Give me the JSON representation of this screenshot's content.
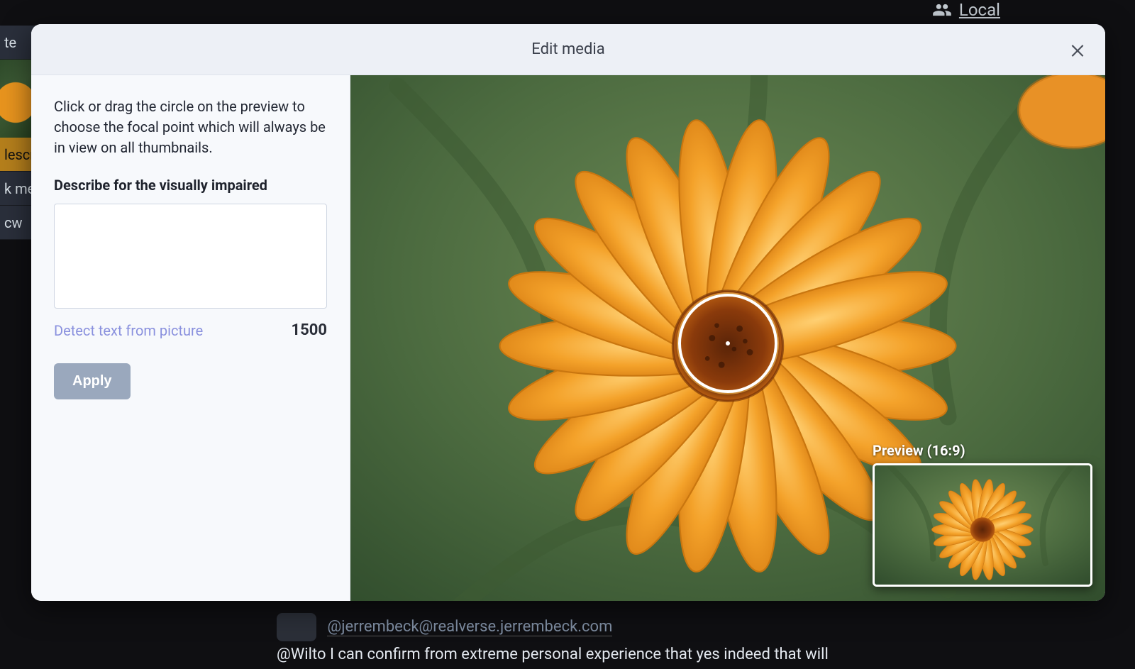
{
  "background": {
    "top_right_link": "Local",
    "left_edge_labels": {
      "te": "te",
      "desc": "lescr",
      "km": "k me",
      "cw": "cw"
    },
    "post": {
      "handle": "@jerrembeck@realverse.jerrembeck.com",
      "line": "@Wilto I can confirm from extreme personal experience that yes indeed that will"
    }
  },
  "modal": {
    "title": "Edit media",
    "instructions": "Click or drag the circle on the preview to choose the focal point which will always be in view on all thumbnails.",
    "describe_label": "Describe for the visually impaired",
    "description_value": "",
    "description_placeholder": "",
    "detect_link": "Detect text from picture",
    "char_remaining": "1500",
    "apply_label": "Apply",
    "preview_label": "Preview (16:9)"
  }
}
